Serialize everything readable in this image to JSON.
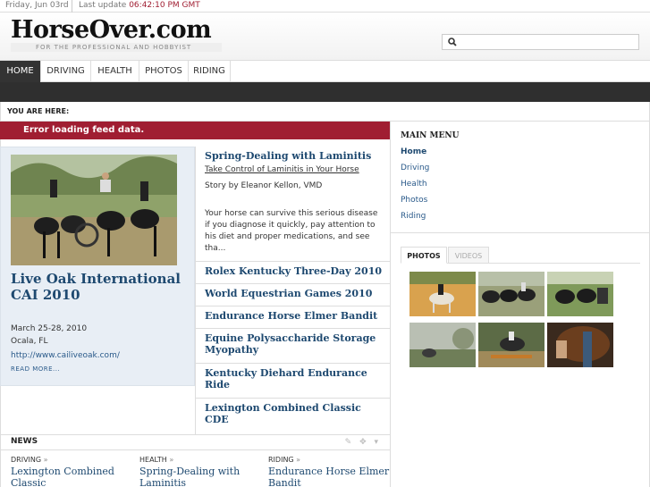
{
  "topbar": {
    "date": "Friday, Jun 03rd",
    "update_label": "Last update",
    "update_time": "06:42:10 PM GMT"
  },
  "header": {
    "logo": "HorseOver.com",
    "tagline": "FOR THE PROFESSIONAL AND HOBBYIST",
    "search_placeholder": ""
  },
  "nav": {
    "items": [
      {
        "label": "HOME"
      },
      {
        "label": "DRIVING"
      },
      {
        "label": "HEALTH"
      },
      {
        "label": "PHOTOS"
      },
      {
        "label": "RIDING"
      }
    ],
    "active_index": 0
  },
  "breadcrumb": {
    "label": "YOU ARE HERE:"
  },
  "feed_error": "Error loading feed data.",
  "event": {
    "title": "Live Oak International CAI 2010",
    "dates": "March 25-28, 2010",
    "location": "Ocala, FL",
    "url": "http://www.cailiveoak.com/",
    "more": "READ MORE..."
  },
  "featured": {
    "title": "Spring-Dealing with Laminitis",
    "subtitle": "Take Control of Laminitis in Your Horse",
    "byline": "Story by Eleanor Kellon, VMD",
    "body": "Your horse can survive this serious disease if you diagnose it quickly, pay attention to his diet and proper medications, and see tha..."
  },
  "middle_links": [
    "Rolex Kentucky Three-Day 2010",
    "World Equestrian Games 2010",
    "Endurance Horse Elmer Bandit",
    "Equine Polysaccharide Storage Myopathy",
    "Kentucky Diehard Endurance Ride",
    "Lexington Combined Classic CDE"
  ],
  "news": {
    "label": "NEWS",
    "columns": [
      {
        "category": "DRIVING",
        "arrow": "»",
        "title": "Lexington Combined Classic"
      },
      {
        "category": "HEALTH",
        "arrow": "»",
        "title": "Spring-Dealing with Laminitis"
      },
      {
        "category": "RIDING",
        "arrow": "»",
        "title": "Endurance Horse Elmer Bandit"
      }
    ]
  },
  "main_menu": {
    "title": "MAIN MENU",
    "items": [
      "Home",
      "Driving",
      "Health",
      "Photos",
      "Riding"
    ]
  },
  "media_tabs": {
    "photos": "PHOTOS",
    "videos": "VIDEOS"
  },
  "colors": {
    "accent_red": "#a01e32",
    "link_blue": "#1e4970",
    "dark_bar": "#2f2f2f"
  }
}
